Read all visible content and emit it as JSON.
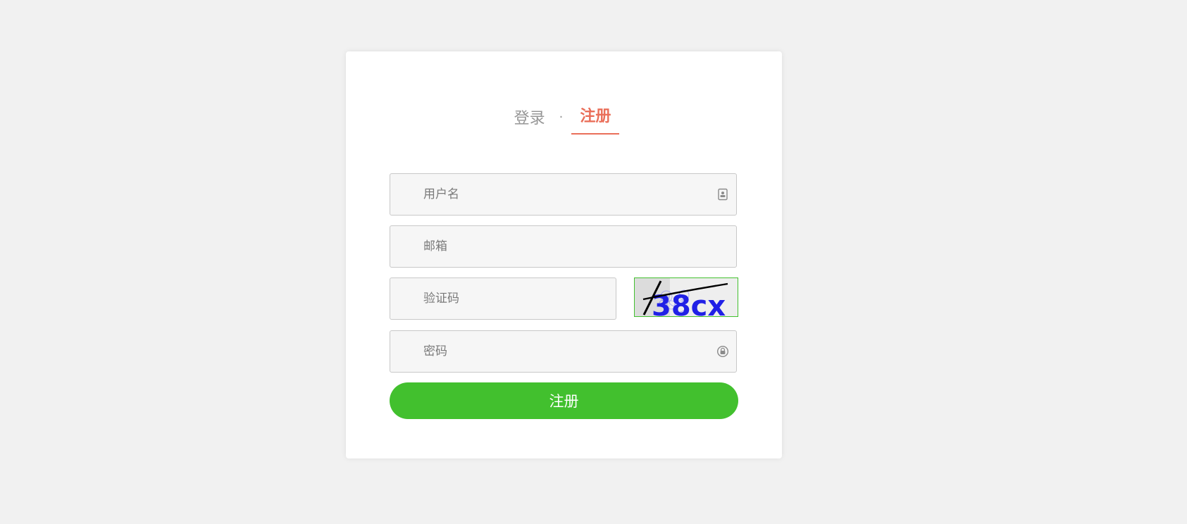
{
  "tabs": {
    "login": "登录",
    "separator": "·",
    "register": "注册"
  },
  "fields": {
    "username": {
      "placeholder": "用户名",
      "icon": "contact-card-icon"
    },
    "email": {
      "placeholder": "邮箱"
    },
    "captcha": {
      "placeholder": "验证码",
      "image_text": "38cx"
    },
    "password": {
      "placeholder": "密码",
      "icon": "lock-circle-icon"
    }
  },
  "submit_label": "注册",
  "colors": {
    "accent": "#ea6f5a",
    "primary": "#42c02e",
    "background": "#f1f1f1"
  }
}
